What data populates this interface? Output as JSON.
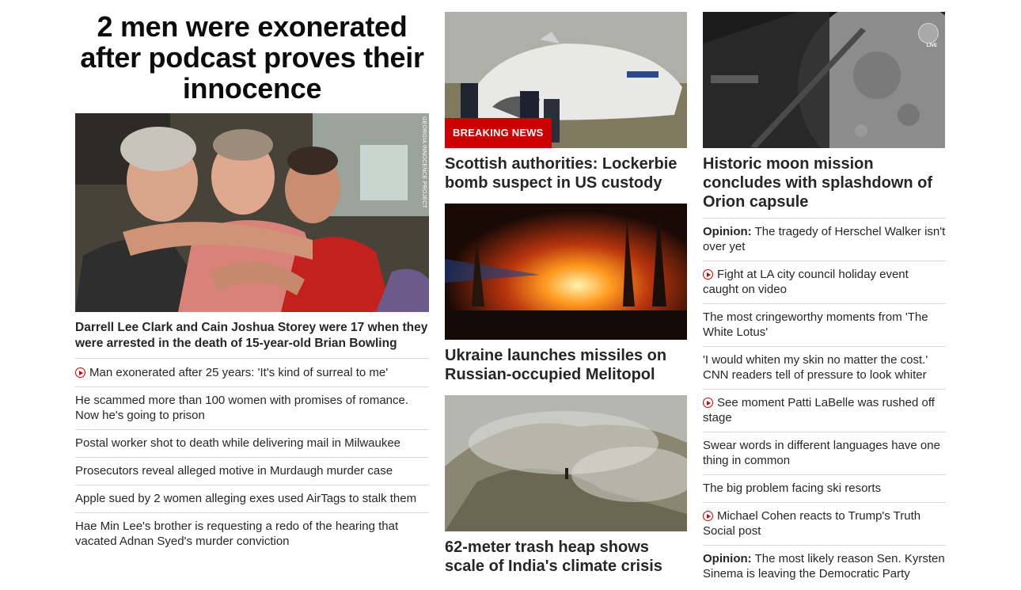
{
  "main": {
    "headline": "2 men were exonerated after podcast proves their innocence",
    "image_credit": "GEORGIA INNOCENCE PROJECT",
    "caption": "Darrell Lee Clark and Cain Joshua Storey were 17 when they were arrested in the death of 15-year-old Brian Bowling",
    "related": [
      {
        "text": "Man exonerated after 25 years: 'It's kind of surreal to me'",
        "video": true
      },
      {
        "text": "He scammed more than 100 women with promises of romance. Now he's going to prison",
        "video": false
      },
      {
        "text": "Postal worker shot to death while delivering mail in Milwaukee",
        "video": false
      },
      {
        "text": "Prosecutors reveal alleged motive in Murdaugh murder case",
        "video": false
      },
      {
        "text": "Apple sued by 2 women alleging exes used AirTags to stalk them",
        "video": false
      },
      {
        "text": "Hae Min Lee's brother is requesting a redo of the hearing that vacated Adnan Syed's murder conviction",
        "video": false
      }
    ]
  },
  "middle": {
    "stories": [
      {
        "badge": "BREAKING NEWS",
        "title": "Scottish authorities: Lockerbie bomb suspect in US custody",
        "image": "plane-wreckage-photo"
      },
      {
        "title": "Ukraine launches missiles on Russian-occupied Melitopol",
        "image": "night-fire-photo"
      },
      {
        "title": "62-meter trash heap shows scale of India's climate crisis",
        "image": "smoking-trash-heap-photo"
      }
    ]
  },
  "right": {
    "top_story": {
      "title": "Historic moon mission concludes with splashdown of Orion capsule",
      "image": "moon-from-orion-photo",
      "live_label": "LIVE"
    },
    "items": [
      {
        "label": "Opinion:",
        "text": "The tragedy of Herschel Walker isn't over yet",
        "video": false
      },
      {
        "label": "",
        "text": "Fight at LA city council holiday event caught on video",
        "video": true
      },
      {
        "label": "",
        "text": "The most cringeworthy moments from 'The White Lotus'",
        "video": false
      },
      {
        "label": "",
        "text": "'I would whiten my skin no matter the cost.' CNN readers tell of pressure to look whiter",
        "video": false
      },
      {
        "label": "",
        "text": "See moment Patti LaBelle was rushed off stage",
        "video": true
      },
      {
        "label": "",
        "text": "Swear words in different languages have one thing in common",
        "video": false
      },
      {
        "label": "",
        "text": "The big problem facing ski resorts",
        "video": false
      },
      {
        "label": "",
        "text": "Michael Cohen reacts to Trump's Truth Social post",
        "video": true
      },
      {
        "label": "Opinion:",
        "text": "The most likely reason Sen. Kyrsten Sinema is leaving the Democratic Party",
        "video": false
      }
    ]
  },
  "colors": {
    "accent": "#cc0000",
    "text": "#262626",
    "divider": "#d9d9d9"
  }
}
